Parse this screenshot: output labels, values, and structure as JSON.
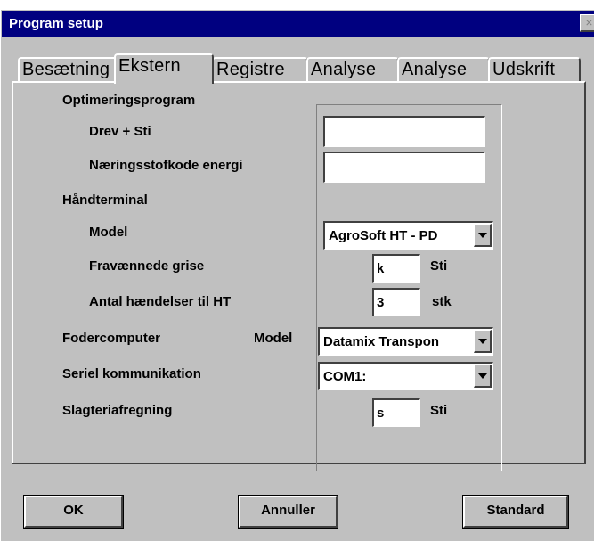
{
  "window": {
    "title": "Program setup",
    "close_glyph": "×"
  },
  "tabs": [
    {
      "label": "Besætning",
      "active": false
    },
    {
      "label": "Ekstern",
      "active": true
    },
    {
      "label": "Registre",
      "active": false
    },
    {
      "label": "Analyse",
      "active": false
    },
    {
      "label": "Analyse",
      "active": false
    },
    {
      "label": "Udskrift",
      "active": false
    }
  ],
  "optimering": {
    "heading": "Optimeringsprogram",
    "drev_label": "Drev + Sti",
    "drev_value": "",
    "naering_label": "Næringsstofkode energi",
    "naering_value": ""
  },
  "handterminal": {
    "heading": "Håndterminal",
    "model_label": "Model",
    "model_value": "AgroSoft HT - PD",
    "fravaenn_label": "Fravænnede grise",
    "fravaenn_value": "k",
    "fravaenn_unit": "Sti",
    "antal_label": "Antal hændelser til HT",
    "antal_value": "3",
    "antal_unit": "stk"
  },
  "fodercomputer": {
    "label": "Fodercomputer",
    "model_label": "Model",
    "model_value": "Datamix Transpon"
  },
  "seriel": {
    "label": "Seriel kommunikation",
    "value": "COM1:"
  },
  "slagteri": {
    "label": "Slagteriafregning",
    "value": "s",
    "unit": "Sti"
  },
  "buttons": {
    "ok": "OK",
    "cancel": "Annuller",
    "standard": "Standard"
  }
}
